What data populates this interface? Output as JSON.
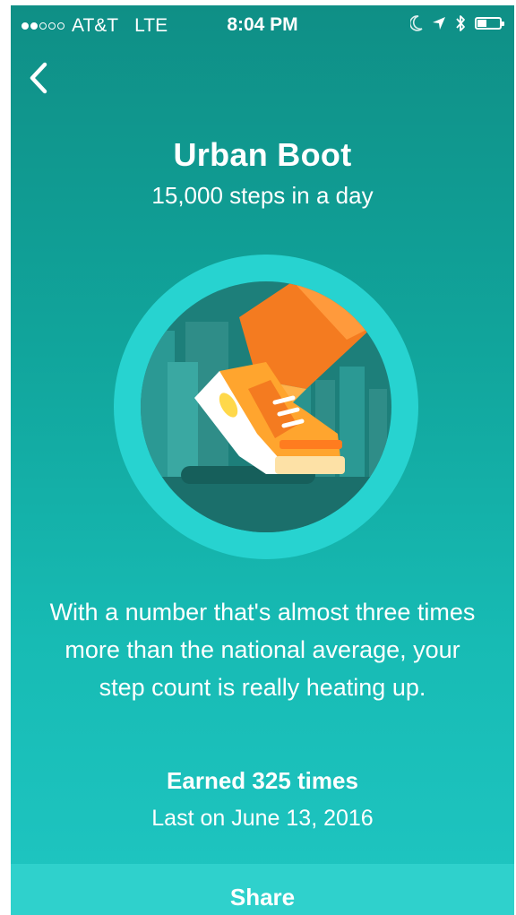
{
  "status_bar": {
    "carrier": "AT&T",
    "network": "LTE",
    "time": "8:04 PM",
    "signal_filled": 2,
    "signal_total": 5,
    "icons": [
      "moon-icon",
      "location-icon",
      "bluetooth-icon",
      "battery-icon"
    ]
  },
  "nav": {
    "back_icon": "chevron-left-icon"
  },
  "badge": {
    "title": "Urban Boot",
    "subtitle": "15,000 steps in a day",
    "illustration": "boot-icon",
    "description": "With a number that's almost three times more than the national average, your step count is really heating up.",
    "earned": "Earned 325 times",
    "last": "Last on June 13, 2016"
  },
  "actions": {
    "share_label": "Share"
  },
  "colors": {
    "background_top": "#0f8f86",
    "background_bottom": "#1fc6c2",
    "ring": "#27d3d0",
    "boot_orange": "#f47b20",
    "share_bar": "#2fd1cc"
  }
}
